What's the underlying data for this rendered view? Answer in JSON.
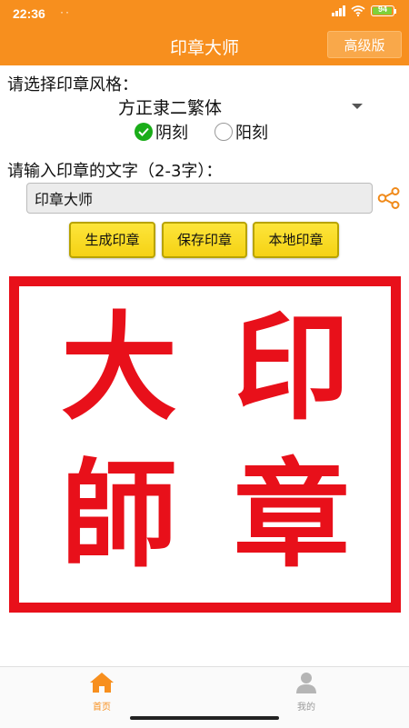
{
  "status_bar": {
    "time": "22:36",
    "dots": "··",
    "battery_level": "94",
    "battery_fraction": 0.94
  },
  "app_bar": {
    "title": "印章大师",
    "advanced_button": "高级版",
    "background_color": "#f78f1e"
  },
  "style_section": {
    "label": "请选择印章风格：",
    "font_style_value": "方正隶二繁体",
    "radio_options": [
      {
        "label": "阴刻",
        "selected": true
      },
      {
        "label": "阳刻",
        "selected": false
      }
    ]
  },
  "text_section": {
    "label": "请输入印章的文字（2-3字）：",
    "input_value": "印章大师"
  },
  "buttons": {
    "generate": "生成印章",
    "save": "保存印章",
    "local": "本地印章"
  },
  "seal": {
    "color": "#e8101a",
    "characters": {
      "top_left": "大",
      "top_right": "印",
      "bottom_left": "師",
      "bottom_right": "章"
    }
  },
  "tab_bar": {
    "tabs": [
      {
        "label": "首页",
        "icon": "home-icon",
        "active": true
      },
      {
        "label": "我的",
        "icon": "profile-icon",
        "active": false
      }
    ],
    "active_color": "#f78f1e",
    "inactive_color": "#999999"
  }
}
